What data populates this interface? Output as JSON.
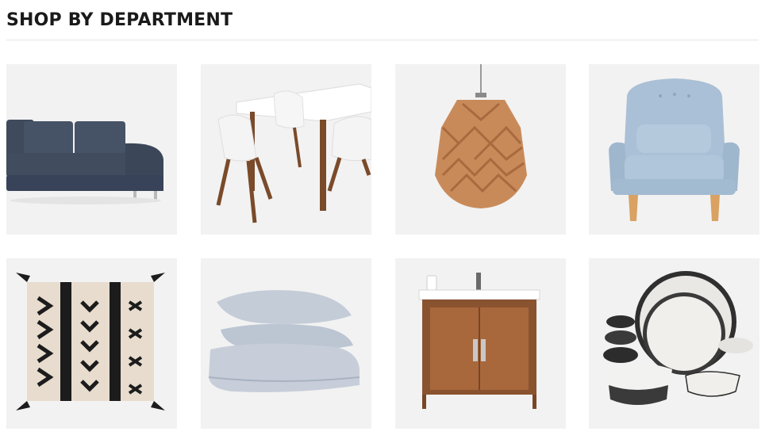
{
  "section": {
    "title": "SHOP BY DEPARTMENT"
  },
  "colors": {
    "tile_background": "#f2f2f2",
    "title": "#1a1a1a",
    "divider": "#e6e6e6"
  },
  "departments": [
    {
      "icon": "sofa-icon"
    },
    {
      "icon": "dining-set-icon"
    },
    {
      "icon": "pendant-lamp-icon"
    },
    {
      "icon": "armchair-icon"
    },
    {
      "icon": "throw-pillow-icon"
    },
    {
      "icon": "bedding-icon"
    },
    {
      "icon": "bathroom-vanity-icon"
    },
    {
      "icon": "dinnerware-icon"
    }
  ]
}
